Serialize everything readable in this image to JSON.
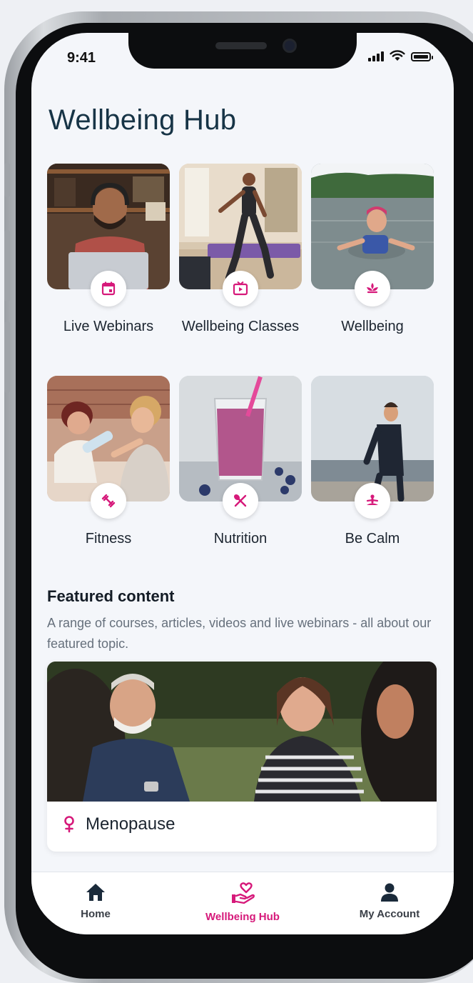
{
  "status_bar": {
    "time": "9:41"
  },
  "page_title": "Wellbeing Hub",
  "tiles": [
    {
      "label": "Live Webinars",
      "icon": "calendar-icon"
    },
    {
      "label": "Wellbeing Classes",
      "icon": "video-icon"
    },
    {
      "label": "Wellbeing",
      "icon": "lotus-icon"
    },
    {
      "label": "Fitness",
      "icon": "dumbbell-icon"
    },
    {
      "label": "Nutrition",
      "icon": "cutlery-icon"
    },
    {
      "label": "Be Calm",
      "icon": "meditation-icon"
    }
  ],
  "featured": {
    "heading": "Featured content",
    "description": "A range of courses, articles, videos and live webinars - all about our featured topic.",
    "card": {
      "title": "Menopause",
      "icon": "female-symbol-icon"
    }
  },
  "tabbar": {
    "items": [
      {
        "label": "Home",
        "icon": "home-icon"
      },
      {
        "label": "Wellbeing Hub",
        "icon": "hand-heart-icon",
        "active": true
      },
      {
        "label": "My Account",
        "icon": "person-icon"
      }
    ]
  },
  "colors": {
    "accent": "#d6197a",
    "title": "#173446",
    "text": "#1c2530",
    "muted": "#66707c"
  }
}
